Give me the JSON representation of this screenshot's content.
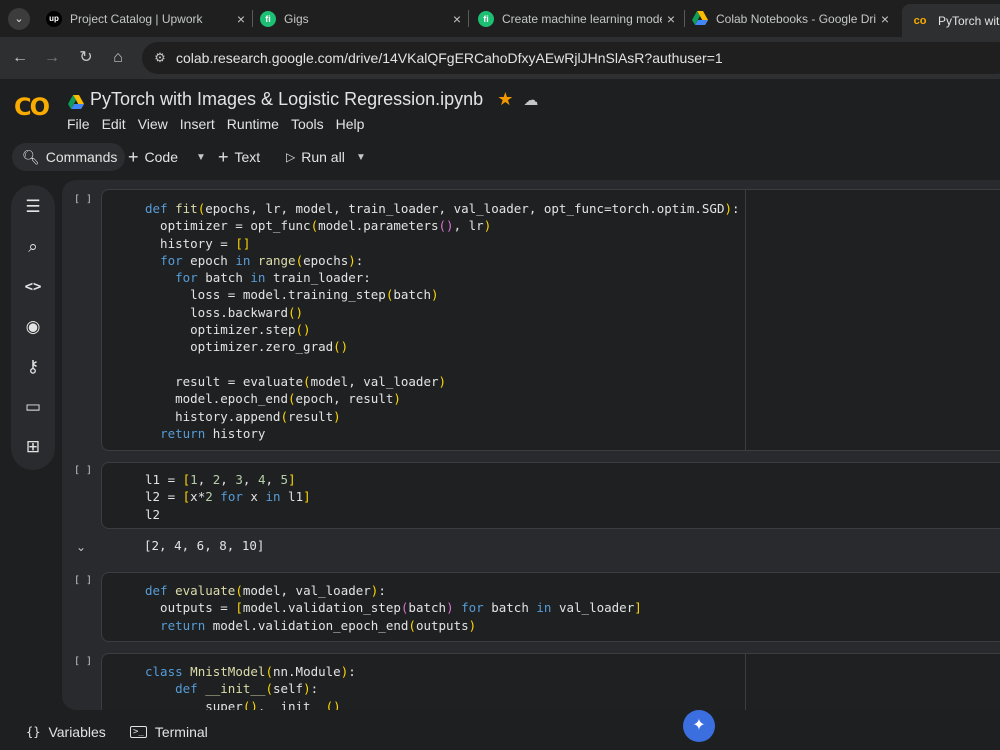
{
  "browser": {
    "tabs": [
      {
        "title": "Project Catalog | Upwork",
        "favicon": "upwork-icon",
        "fav_text": "up",
        "color": "#14a800"
      },
      {
        "title": "Gigs",
        "favicon": "fiverr-icon",
        "fav_text": "fi",
        "color": "#1dbf73"
      },
      {
        "title": "Create machine learning model",
        "favicon": "fiverr-icon",
        "fav_text": "fi",
        "color": "#1dbf73"
      },
      {
        "title": "Colab Notebooks - Google Driv",
        "favicon": "google-drive-icon",
        "fav_text": "",
        "color": "#4285f4"
      },
      {
        "title": "PyTorch with I",
        "favicon": "colab-icon",
        "fav_text": "co",
        "color": "#f9ab00"
      }
    ],
    "close_glyph": "×",
    "url": "colab.research.google.com/drive/14VKalQFgERCahoDfxyAEwRjlJHnSlAsR?authuser=1"
  },
  "colab": {
    "logo": "CO",
    "notebook_title": "PyTorch with Images & Logistic Regression.ipynb",
    "menu": [
      "File",
      "Edit",
      "View",
      "Insert",
      "Runtime",
      "Tools",
      "Help"
    ],
    "toolbar": {
      "commands": "Commands",
      "code": "Code",
      "text": "Text",
      "run_all": "Run all"
    }
  },
  "cells": {
    "run_label": "[ ]",
    "output_1": "[2, 4, 6, 8, 10]"
  },
  "bottom": {
    "variables": "Variables",
    "terminal": "Terminal"
  },
  "colors": {
    "accent_star": "#f29900",
    "colab_orange": "#f9ab00",
    "gemini_blue": "#3b6fe0"
  }
}
